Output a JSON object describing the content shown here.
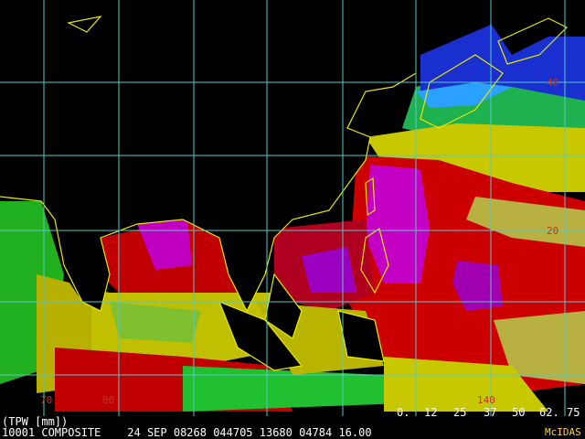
{
  "legend": {
    "ticks": [
      "0.",
      "12",
      "25",
      "37",
      "50",
      "62.",
      "75"
    ],
    "colors": [
      "#0000a8",
      "#0090ff",
      "#00e0e0",
      "#00c800",
      "#dede00",
      "#d00000",
      "#d800d8"
    ]
  },
  "status": {
    "title": "(TPW [mm])",
    "line": "10001 COMPOSITE    24 SEP 08268 044705 13680 04784 16.00",
    "credit": "McIDAS"
  },
  "grid_labels": {
    "lat": [
      "40",
      "20"
    ],
    "lon": [
      "70",
      "80",
      "140"
    ]
  }
}
